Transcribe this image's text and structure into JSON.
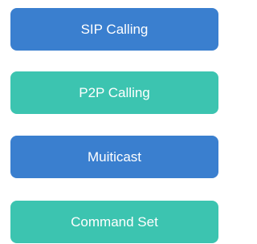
{
  "buttons": [
    {
      "label": "SIP Calling",
      "color": "#3a7fcf"
    },
    {
      "label": "P2P Calling",
      "color": "#3cc4b0"
    },
    {
      "label": "Muiticast",
      "color": "#3a7fcf"
    },
    {
      "label": "Command Set",
      "color": "#3cc4b0"
    }
  ]
}
